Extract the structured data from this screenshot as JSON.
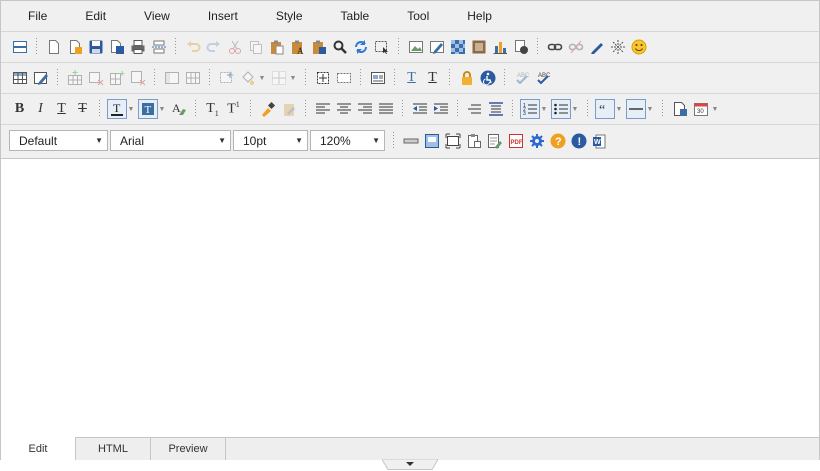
{
  "menu": [
    "File",
    "Edit",
    "View",
    "Insert",
    "Style",
    "Table",
    "Tool",
    "Help"
  ],
  "format_selects": [
    {
      "value": "Default"
    },
    {
      "value": "Arial"
    },
    {
      "value": "10pt"
    },
    {
      "value": "120%"
    }
  ],
  "tabs": [
    {
      "label": "Edit",
      "active": true
    },
    {
      "label": "HTML",
      "active": false
    },
    {
      "label": "Preview",
      "active": false
    }
  ],
  "colors": {
    "accent_blue": "#3a7ad5",
    "orange": "#f0a020",
    "text_dark": "#222222"
  }
}
